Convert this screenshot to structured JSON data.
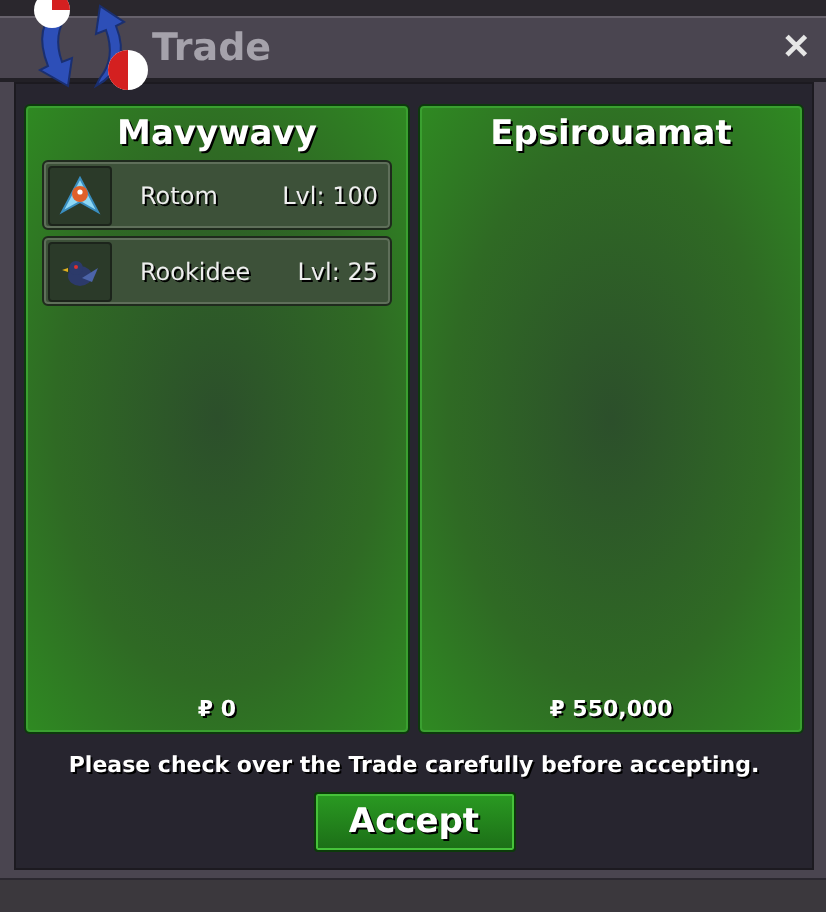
{
  "window": {
    "title": "Trade",
    "close": "✕"
  },
  "offers": [
    {
      "trainer": "Mavywavy",
      "money": "₽ 0",
      "pokemon": [
        {
          "name": "Rotom",
          "level": "Lvl: 100",
          "kind": "electric"
        },
        {
          "name": "Rookidee",
          "level": "Lvl: 25",
          "kind": "bird"
        }
      ]
    },
    {
      "trainer": "Epsirouamat",
      "money": "₽ 550,000"
    }
  ],
  "message": "Please check over the Trade carefully before accepting.",
  "accept_button": "Accept"
}
